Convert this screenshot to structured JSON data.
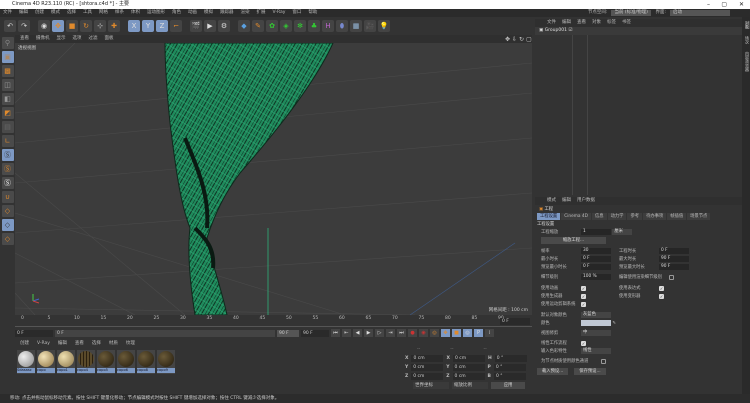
{
  "window": {
    "title": "Cinema 4D R23.110 (RC) - [shtora.c4d *] - 主要",
    "minimize": "–",
    "maximize": "▢",
    "close": "✕"
  },
  "menu": [
    "文件",
    "编辑",
    "创建",
    "模式",
    "选择",
    "工具",
    "网格",
    "样条",
    "体积",
    "运动图形",
    "角色",
    "动画",
    "模拟",
    "跟踪器",
    "渲染",
    "扩展",
    "V-Ray",
    "窗口",
    "帮助"
  ],
  "node_space": {
    "label": "节点空间:",
    "value": "当前 (标准/物理)",
    "layout_label": "界面:",
    "layout_value": "启动"
  },
  "viewport": {
    "menu": [
      "查看",
      "摄像机",
      "显示",
      "选项",
      "过滤",
      "面板"
    ],
    "label": "透视视图",
    "grid_info": "网格间距 : 100 cm"
  },
  "timeline": {
    "ticks": [
      "0",
      "5",
      "10",
      "15",
      "20",
      "25",
      "30",
      "35",
      "40",
      "45",
      "50",
      "55",
      "60",
      "65",
      "70",
      "75",
      "80",
      "85",
      "90"
    ],
    "current": "0 F",
    "start": "0 F",
    "end": "90 F",
    "end2": "90 F",
    "preview_end": "0 F"
  },
  "materials": {
    "menu": [
      "创建",
      "V-Ray",
      "编辑",
      "查看",
      "选择",
      "材质",
      "纹理"
    ],
    "items": [
      "Sdasasc",
      "copo",
      "copo1",
      "copo4",
      "copo5",
      "copo6",
      "copo8",
      "copo9"
    ]
  },
  "coords": {
    "x": "0 cm",
    "y": "0 cm",
    "z": "0 cm",
    "sx": "0 cm",
    "sy": "0 cm",
    "sz": "0 cm",
    "h": "0 °",
    "p": "0 °",
    "b": "0 °",
    "mode": "世界坐标",
    "scale_mode": "缩放比例",
    "apply": "应用",
    "col1": "--",
    "col2": "--",
    "col3": "--"
  },
  "status": "移动: 点击并拖动鼠标移动元素。按住 SHIFT 键量化移动；节点编辑模式时按住 SHIFT 键增加选择对象；按住 CTRL 键减少选择对象。",
  "object_manager": {
    "menu": [
      "文件",
      "编辑",
      "查看",
      "对象",
      "标签",
      "书签"
    ],
    "objects": [
      "Group001"
    ]
  },
  "attributes": {
    "menu": [
      "模式",
      "编辑",
      "用户数据"
    ],
    "title": "工程",
    "tabs": [
      "工程设置",
      "Cinema 4D",
      "信息",
      "动力学",
      "参考",
      "待办事项",
      "帧插值",
      "场景节点"
    ],
    "section": "工程设置",
    "scale_label": "工程缩放",
    "scale_value": "1",
    "scale_unit": "厘米",
    "scale_btn": "缩放工程...",
    "fps_label": "帧率",
    "fps": "30",
    "project_time_label": "工程时长",
    "project_time": "0 F",
    "min_time_label": "最小时长",
    "min_time": "0 F",
    "max_time_label": "最大时长",
    "max_time": "90 F",
    "preview_min_label": "预览最小时长",
    "preview_min": "0 F",
    "preview_max_label": "预览最大时长",
    "preview_max": "90 F",
    "lod_label": "细节级别",
    "lod": "100 %",
    "render_lod_label": "编辑使用渲染细节级别",
    "use_anim": "使用动画",
    "use_expr": "使用表达式",
    "use_gen": "使用生成器",
    "use_deform": "使用变形器",
    "use_motion": "使用运动剪辑系统",
    "default_color_label": "默认对象颜色",
    "default_color": "灰蓝色",
    "color_label": "颜色",
    "view_clip_label": "视图修剪",
    "view_clip": "中",
    "linear_label": "线性工作流程",
    "input_color_label": "输入色彩特性",
    "input_color": "线性",
    "node_color_label": "为节点材质使用颜色通道",
    "load_preset": "载入预设...",
    "save_preset": "保存预设..."
  },
  "right_tabs": [
    "对象",
    "场次",
    "内容浏览器"
  ],
  "colors": {
    "accent": "#7d99c4",
    "curtain": "#1f8a5c"
  }
}
